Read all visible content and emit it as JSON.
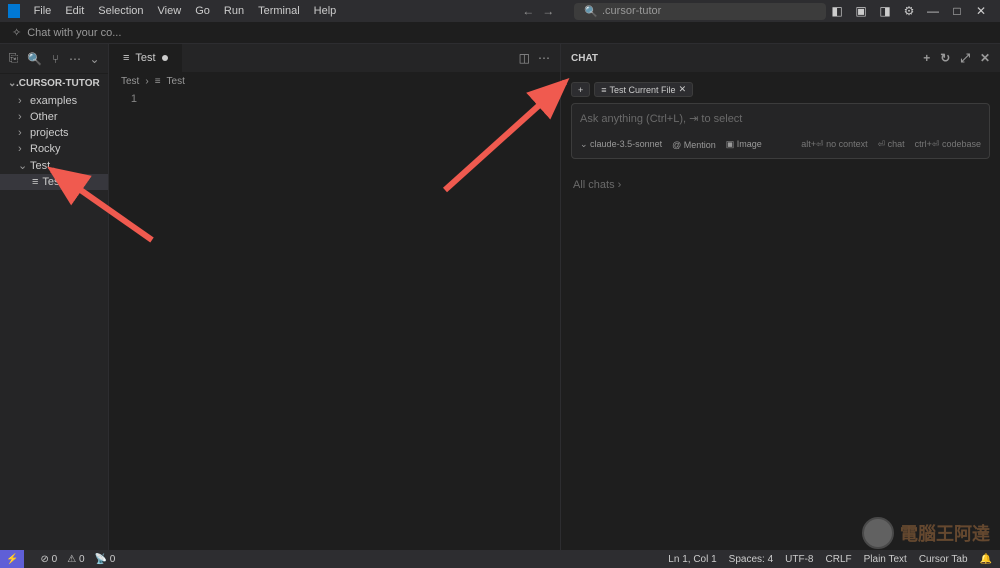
{
  "menu": [
    "File",
    "Edit",
    "Selection",
    "View",
    "Go",
    "Run",
    "Terminal",
    "Help"
  ],
  "search": {
    "text": ".cursor-tutor"
  },
  "banner": "Chat with your co...",
  "explorer": {
    "root": ".CURSOR-TUTOR",
    "items": [
      "examples",
      "Other",
      "projects",
      "Rocky"
    ],
    "folder": "Test",
    "file": "Test"
  },
  "tab": {
    "name": "Test"
  },
  "breadcrumb": {
    "a": "Test",
    "b": "Test"
  },
  "gutter": {
    "l1": "1"
  },
  "chat": {
    "title": "CHAT",
    "chip_add": "+",
    "chip_file": "Test Current File",
    "placeholder": "Ask anything (Ctrl+L), ⇥ to select",
    "model": "claude-3.5-sonnet",
    "mention": "Mention",
    "image": "Image",
    "hint_nocontext": "alt+⏎ no context",
    "hint_chat": "chat",
    "hint_codebase": "ctrl+⏎ codebase",
    "all": "All chats"
  },
  "status": {
    "errors": "0",
    "warnings": "0",
    "ports": "0",
    "ln": "Ln 1, Col 1",
    "spaces": "Spaces: 4",
    "enc": "UTF-8",
    "eol": "CRLF",
    "lang": "Plain Text",
    "cursor": "Cursor Tab"
  },
  "watermark": "電腦王阿達"
}
